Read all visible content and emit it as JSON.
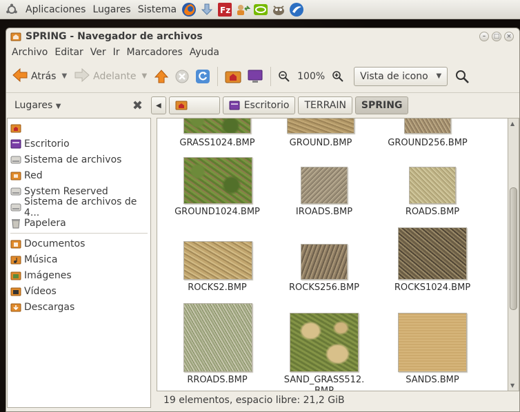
{
  "panel": {
    "menus": [
      "Aplicaciones",
      "Lugares",
      "Sistema"
    ],
    "launchers": [
      "firefox-icon",
      "download-icon",
      "filezilla-icon",
      "transfer-icon",
      "nvidia-icon",
      "gimp-icon",
      "spring-launcher-icon"
    ]
  },
  "window": {
    "title": "SPRING - Navegador de archivos",
    "menu": [
      "Archivo",
      "Editar",
      "Ver",
      "Ir",
      "Marcadores",
      "Ayuda"
    ],
    "toolbar": {
      "back": "Atrás",
      "forward": "Adelante",
      "zoom": "100%",
      "view_mode": "Vista de icono"
    },
    "sidebar_header": "Lugares",
    "pathbar": [
      "Escritorio",
      "TERRAIN",
      "SPRING"
    ],
    "sidebar": {
      "devices": [
        {
          "label": "",
          "icon": "home-folder-icon"
        },
        {
          "label": "Escritorio",
          "icon": "desktop-icon"
        },
        {
          "label": "Sistema de archivos",
          "icon": "drive-icon"
        },
        {
          "label": "Red",
          "icon": "network-icon"
        },
        {
          "label": "System Reserved",
          "icon": "drive-icon"
        },
        {
          "label": "Sistema de archivos de 4...",
          "icon": "drive-icon"
        },
        {
          "label": "Papelera",
          "icon": "trash-icon"
        }
      ],
      "bookmarks": [
        {
          "label": "Documentos",
          "icon": "documents-folder-icon"
        },
        {
          "label": "Música",
          "icon": "music-folder-icon"
        },
        {
          "label": "Imágenes",
          "icon": "pictures-folder-icon"
        },
        {
          "label": "Vídeos",
          "icon": "videos-folder-icon"
        },
        {
          "label": "Descargas",
          "icon": "downloads-folder-icon"
        }
      ]
    },
    "files": [
      {
        "name": "GRASS1024.BMP"
      },
      {
        "name": "GROUND.BMP"
      },
      {
        "name": "GROUND256.BMP"
      },
      {
        "name": "GROUND1024.BMP"
      },
      {
        "name": "IROADS.BMP"
      },
      {
        "name": "ROADS.BMP"
      },
      {
        "name": "ROCKS2.BMP"
      },
      {
        "name": "ROCKS256.BMP"
      },
      {
        "name": "ROCKS1024.BMP"
      },
      {
        "name": "RROADS.BMP"
      },
      {
        "name": "SAND_GRASS512.\nBMP"
      },
      {
        "name": "SANDS.BMP"
      }
    ],
    "status": "19 elementos, espacio libre: 21,2 GiB"
  }
}
